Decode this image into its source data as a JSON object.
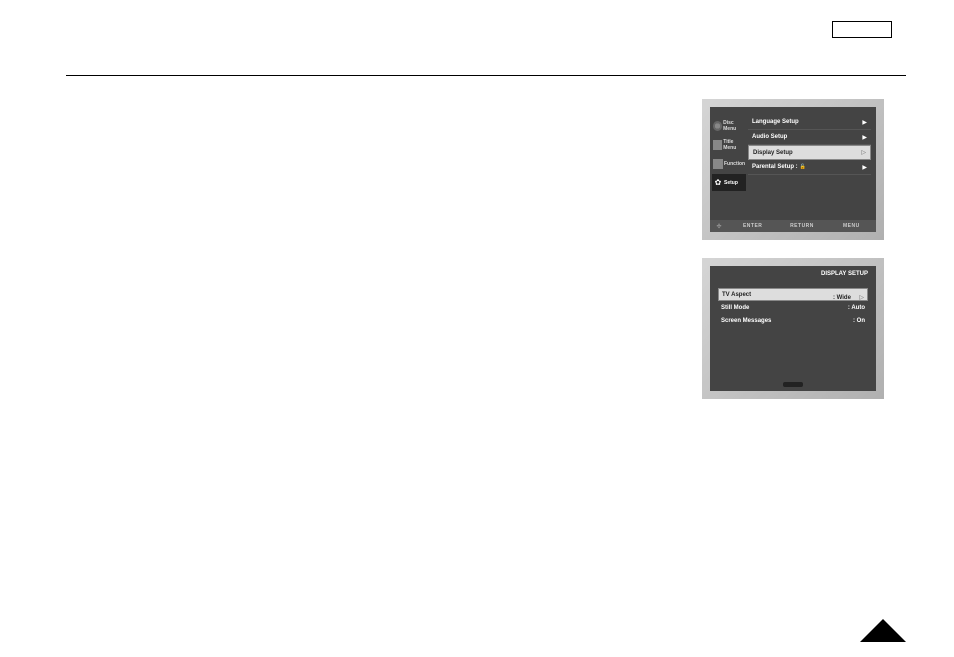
{
  "header_box": "",
  "menu_screen": {
    "sidebar": [
      {
        "label": "Disc Menu",
        "icon": "disc-icon"
      },
      {
        "label": "Title Menu",
        "icon": "title-icon"
      },
      {
        "label": "Function",
        "icon": "function-icon"
      },
      {
        "label": "Setup",
        "icon": "gear-icon"
      }
    ],
    "items": [
      {
        "label": "Language Setup",
        "arrow": "▶",
        "highlight": false
      },
      {
        "label": "Audio Setup",
        "arrow": "▶",
        "highlight": false
      },
      {
        "label": "Display Setup",
        "arrow": "▷",
        "highlight": true
      },
      {
        "label": "Parental Setup :",
        "arrow": "▶",
        "highlight": false,
        "lock": true
      }
    ],
    "footer": {
      "nav_icon": "✢",
      "enter": "ENTER",
      "return": "RETURN",
      "menu": "MENU"
    }
  },
  "display_screen": {
    "title": "DISPLAY SETUP",
    "rows": [
      {
        "label": "TV Aspect",
        "value": ": Wide",
        "highlight": true,
        "arrow": "▷"
      },
      {
        "label": "Still Mode",
        "value": ": Auto",
        "highlight": false
      },
      {
        "label": "Screen Messages",
        "value": ": On",
        "highlight": false
      }
    ]
  }
}
